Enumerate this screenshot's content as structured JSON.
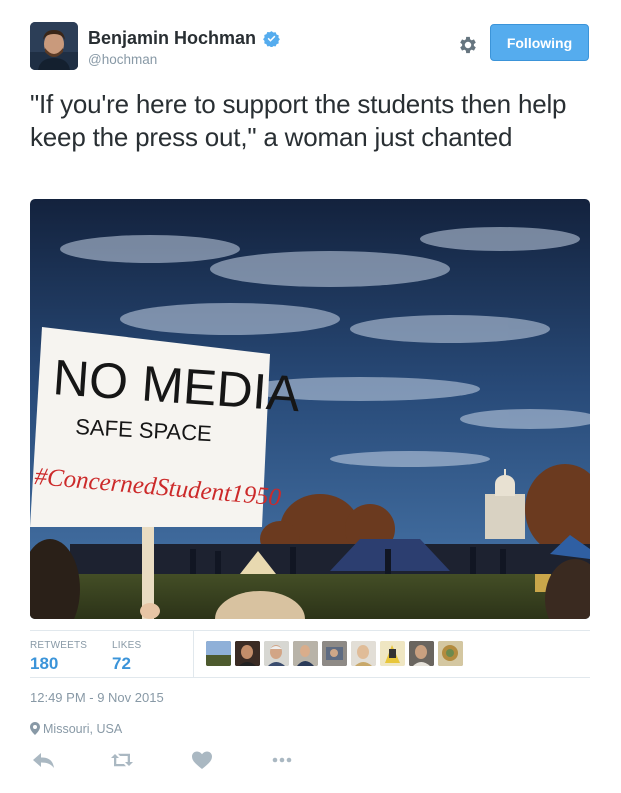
{
  "tweet": {
    "author": {
      "display_name": "Benjamin Hochman",
      "handle": "@hochman",
      "verified": true
    },
    "follow_button_label": "Following",
    "text": "\"If you're here to support the students then help keep the press out,\" a woman just chanted",
    "media": {
      "sign_lines": [
        "NO MEDIA",
        "SAFE SPACE",
        "#ConcernedStudent1950"
      ]
    },
    "stats": {
      "retweets_label": "RETWEETS",
      "retweets_count": "180",
      "likes_label": "LIKES",
      "likes_count": "72"
    },
    "timestamp": "12:49 PM - 9 Nov 2015",
    "location": "Missouri, USA"
  },
  "colors": {
    "accent": "#55acee",
    "link": "#3b94d9",
    "muted": "#8899a6",
    "text": "#292f33",
    "sign_red": "#cc2a2a"
  },
  "icons": {
    "verified": "verified-badge-icon",
    "settings": "gear-icon",
    "location": "map-pin-icon",
    "reply": "reply-icon",
    "retweet": "retweet-icon",
    "like": "heart-icon",
    "more": "more-dots-icon"
  }
}
